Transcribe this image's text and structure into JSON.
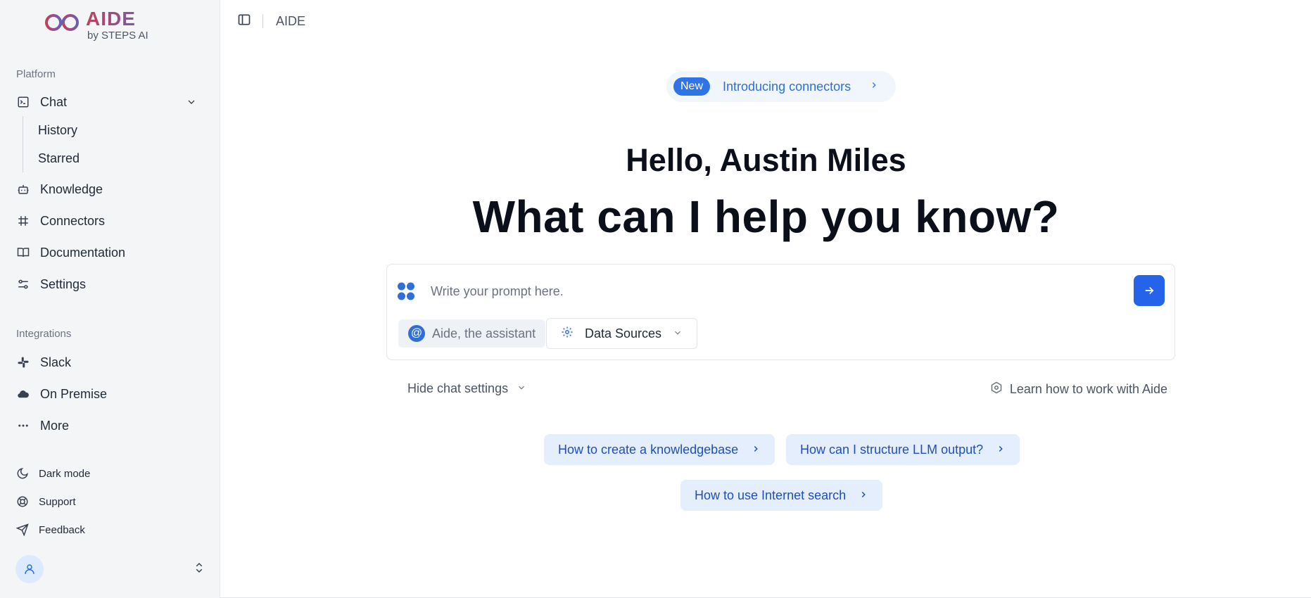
{
  "brand": {
    "title": "AIDE",
    "subtitle": "by STEPS AI"
  },
  "sidebar": {
    "platform_label": "Platform",
    "chat": {
      "label": "Chat",
      "subitems": [
        "History",
        "Starred"
      ]
    },
    "items": [
      "Knowledge",
      "Connectors",
      "Documentation",
      "Settings"
    ],
    "integrations_label": "Integrations",
    "integrations": [
      "Slack",
      "On Premise",
      "More"
    ],
    "footer_items": [
      "Dark mode",
      "Support",
      "Feedback"
    ]
  },
  "topbar": {
    "breadcrumb": "AIDE"
  },
  "announcement": {
    "badge": "New",
    "text": "Introducing connectors"
  },
  "greeting": "Hello, Austin Miles",
  "headline": "What can I help you know?",
  "prompt": {
    "placeholder": "Write your prompt here.",
    "assistant_chip": "Aide, the assistant",
    "data_sources": "Data Sources"
  },
  "settings_toggle": "Hide chat settings",
  "learn_link": "Learn how to work with Aide",
  "suggestions": [
    "How to create a knowledgebase",
    "How can I structure LLM output?",
    "How to use Internet search"
  ],
  "colors": {
    "accent": "#2563eb",
    "suggestion_bg": "#e5eefc",
    "sidebar_bg": "#f4f5f7"
  }
}
